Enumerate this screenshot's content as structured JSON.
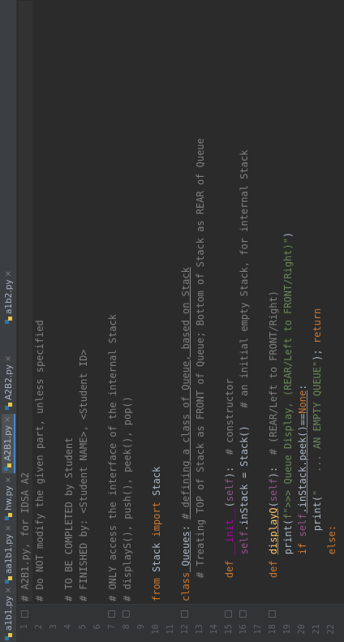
{
  "tabs": [
    {
      "label": "a1b1.py",
      "active": false
    },
    {
      "label": "aa1b1.py",
      "active": false
    },
    {
      "label": "hw.py",
      "active": false
    },
    {
      "label": "A2B1.py",
      "active": true
    },
    {
      "label": "A2B2.py",
      "active": false
    },
    {
      "label": "a1b2.py",
      "active": false
    }
  ],
  "line_numbers": [
    "1",
    "2",
    "3",
    "4",
    "5",
    "6",
    "7",
    "8",
    "9",
    "10",
    "11",
    "12",
    "13",
    "14",
    "15",
    "16",
    "17",
    "18",
    "19",
    "20",
    "21",
    "22"
  ],
  "code": {
    "l1": "# A2B1.py, for IDSA A2",
    "l2": "# Do NOT modify the given part, unless specified",
    "l4": "# TO BE COMPLETED by Student",
    "l5": "# FINISHED by: <Student NAME>, <Student ID>",
    "l7": "# ONLY access the interface of the internal Stack",
    "l8": "# displayS(), push(), peek(), pop()",
    "l10_kw_from": "from",
    "l10_mod": " Stack ",
    "l10_kw_import": "import",
    "l10_name": " Stack",
    "l12_kw": "class",
    "l12_name": " Queues",
    "l12_rest": ": ",
    "l12_comment": "# defining a class of Queue, based on Stack",
    "l13": "# Treating TOP of Stack as FRONT of Queue; Bottom of Stack as REAR of Queue",
    "l15_kw": "def",
    "l15_fn": "__init__",
    "l15_self": "self",
    "l15_comment": "# constructor",
    "l16_self": "self",
    "l16_rest": ".inStack = Stack()",
    "l16_comment": "# an initial empty Stack, for internal Stack",
    "l18_kw": "def",
    "l18_fn": "displayQ",
    "l18_self": "self",
    "l18_comment": "# (REAR/Left to FRONT/Right)",
    "l19_pre": "print(",
    "l19_str": "f\">>> Queue Display, (REAR/Left to FRONT/Right)\"",
    "l19_post": ")",
    "l20_kw": "if",
    "l20_self": "self",
    "l20_rest": ".inStack.peek()==",
    "l20_none": "None",
    "l20_end": ":",
    "l21_pre": "print(",
    "l21_str": "\"   ... AN EMPTY QUEUE\"",
    "l21_mid": "); ",
    "l21_kw": "return",
    "l22_kw": "else:"
  }
}
